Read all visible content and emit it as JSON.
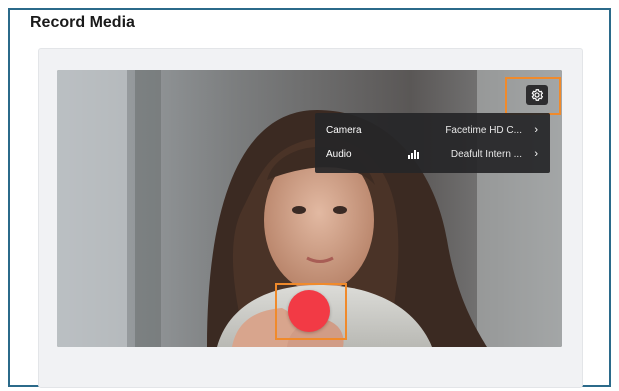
{
  "dialog": {
    "title": "Record Media"
  },
  "settings_menu": {
    "camera_label": "Camera",
    "camera_value": "Facetime HD C...",
    "audio_label": "Audio",
    "audio_value": "Deafult Intern ..."
  },
  "icons": {
    "settings": "gear-icon",
    "camera_chevron": "chevron-right-icon",
    "audio_chevron": "chevron-right-icon",
    "audio_level": "audio-level-icon",
    "record": "record-button"
  },
  "colors": {
    "record": "#f23a45",
    "highlight": "#f08a2b",
    "frame_border": "#2b6a8a",
    "menu_bg": "#262628"
  }
}
